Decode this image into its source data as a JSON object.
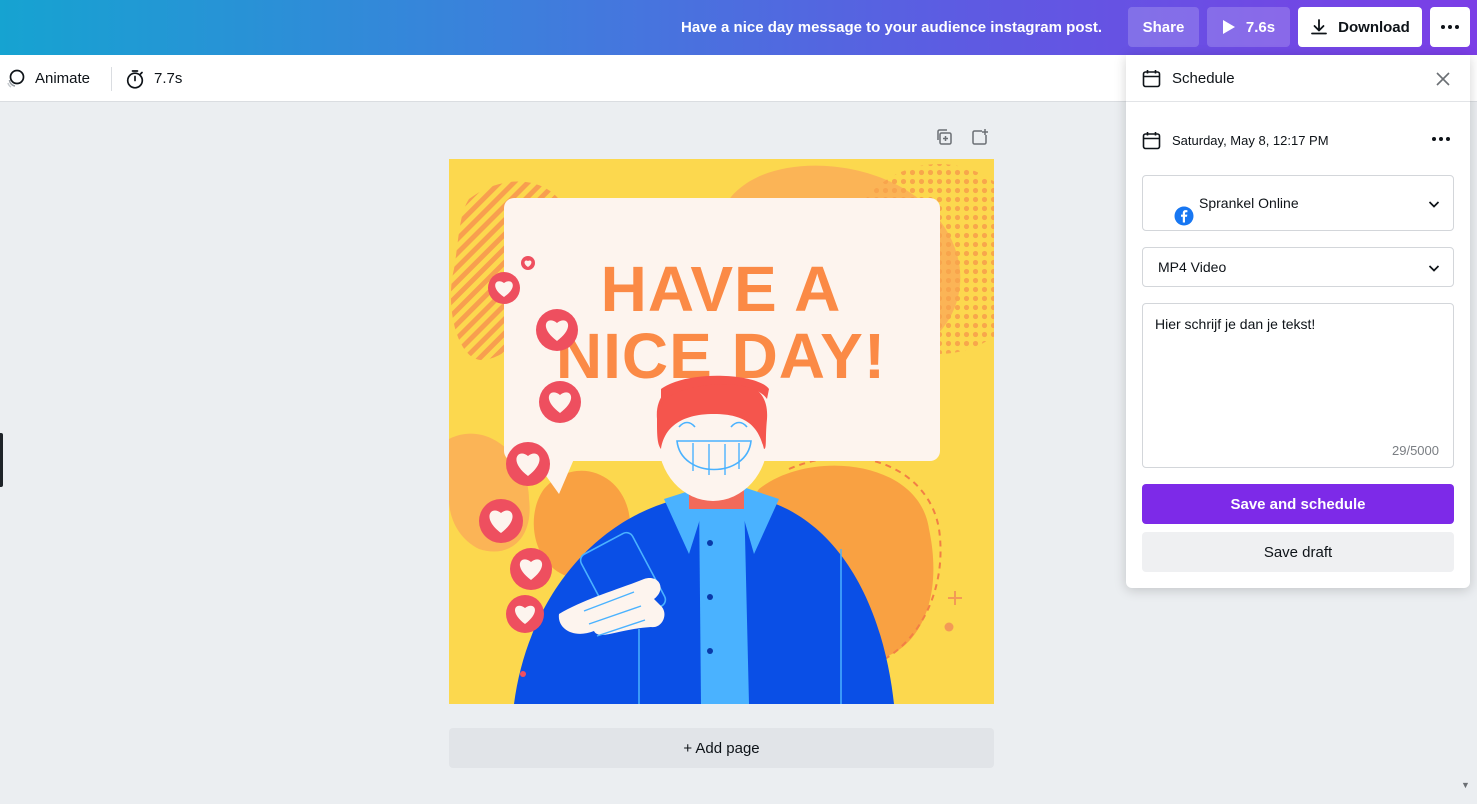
{
  "header": {
    "doc_title": "Have a nice day message to your audience instagram post.",
    "share_label": "Share",
    "play_label": "7.6s",
    "download_label": "Download"
  },
  "toolbar": {
    "animate_label": "Animate",
    "duration_label": "7.7s"
  },
  "design": {
    "headline_line1": "HAVE A",
    "headline_line2": "NICE DAY!"
  },
  "canvas": {
    "add_page_label": "+ Add page"
  },
  "schedule_panel": {
    "title": "Schedule",
    "date_label": "Saturday, May 8, 12:17 PM",
    "account_label": "Sprankel Online",
    "account_icon": "facebook-icon",
    "format_label": "MP4 Video",
    "message_text": "Hier schrijf je dan je tekst!",
    "char_counter": "29/5000",
    "save_schedule_label": "Save and schedule",
    "save_draft_label": "Save draft"
  },
  "colors": {
    "accent_purple": "#7d2ae8",
    "design_yellow": "#fcd84e",
    "headline_orange": "#fb8a46"
  }
}
